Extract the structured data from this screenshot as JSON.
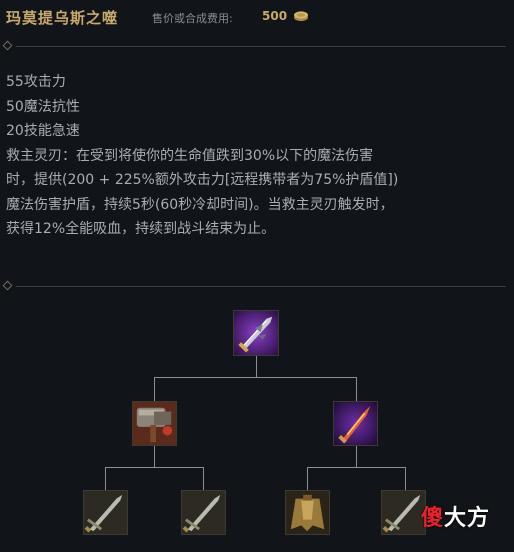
{
  "header": {
    "item_name": "玛莫提乌斯之噬",
    "price_label": "售价或合成费用:",
    "price_value": "500",
    "price_icon": "gold-coins-icon"
  },
  "description": {
    "lines": [
      "55攻击力",
      "50魔法抗性",
      "20技能急速",
      "救主灵刃：在受到将使你的生命值跌到30%以下的魔法伤害",
      "时，提供(200 + 225%额外攻击力[远程携带者为75%护盾值])",
      "魔法伤害护盾，持续5秒(60秒冷却时间)。当救主灵刃触发时，",
      "获得12%全能吸血，持续到战斗结束为止。"
    ]
  },
  "recipe_tree": {
    "root": {
      "icon": "maw-of-malmortius-icon"
    },
    "children": [
      {
        "icon": "cauldron-hammer-icon"
      },
      {
        "icon": "flame-dagger-icon"
      }
    ],
    "leaves": [
      {
        "icon": "long-sword-icon"
      },
      {
        "icon": "long-sword-icon"
      },
      {
        "icon": "null-magic-mantle-icon"
      },
      {
        "icon": "long-sword-icon"
      }
    ]
  },
  "watermark": {
    "part1": "傻",
    "part2": "大方"
  },
  "colors": {
    "background": "#111418",
    "title_gold": "#c8aa6e",
    "body_text": "#a9adb2",
    "tree_line": "#8b8e93",
    "watermark_red": "#e8232a"
  }
}
